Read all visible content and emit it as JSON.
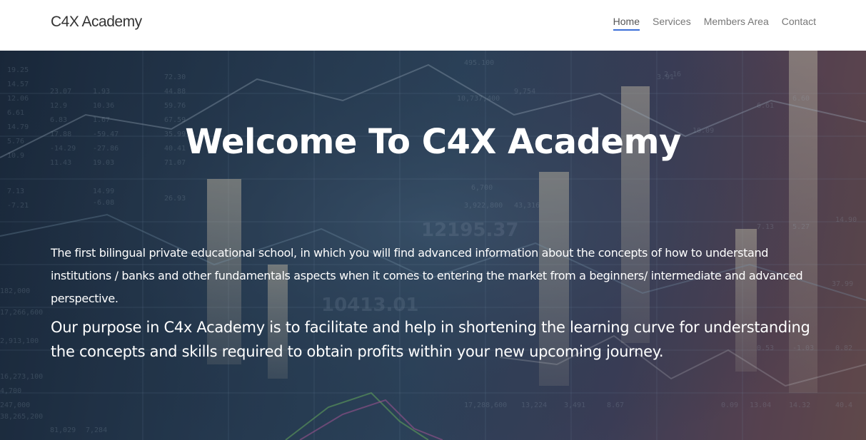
{
  "nav": {
    "brand": "C4X Academy",
    "links": [
      {
        "label": "Home",
        "active": true
      },
      {
        "label": "Services",
        "active": false
      },
      {
        "label": "Members Area",
        "active": false
      },
      {
        "label": "Contact",
        "active": false
      }
    ],
    "active_underline_color": "#3b6fd8"
  },
  "hero": {
    "title": "Welcome To C4X Academy",
    "description": "The first bilingual private educational school, in which you will find advanced information about the concepts of how to understand institutions / banks and other fundamentals aspects when it comes to entering the market from a beginners/ intermediate and advanced perspective.",
    "purpose": "Our purpose in C4x Academy is to facilitate and help in shortening the learning curve for understanding the concepts and skills required to obtain profits within your new upcoming journey.",
    "background_image": "financial-charts-background"
  }
}
